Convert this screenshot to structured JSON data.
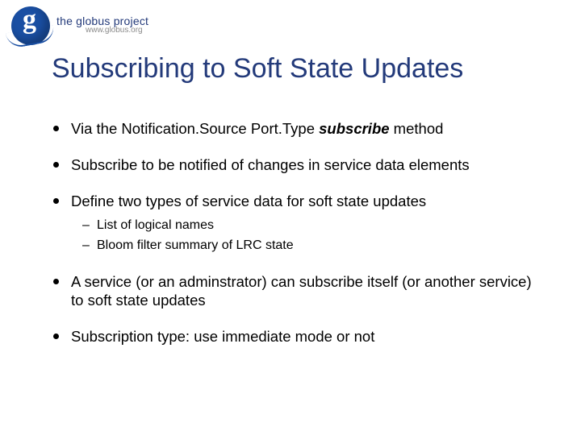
{
  "logo": {
    "title": "the globus project",
    "url": "www.globus.org"
  },
  "title": "Subscribing to Soft State Updates",
  "bullets": {
    "b1_pre": "Via the Notification.Source Port.Type ",
    "b1_kw": "subscribe",
    "b1_post": " method",
    "b2": "Subscribe to be notified of changes in service data elements",
    "b3": "Define two types of service data for soft state updates",
    "b3_sub1": "List of logical names",
    "b3_sub2": "Bloom filter summary of LRC state",
    "b4": "A service (or an adminstrator) can subscribe itself (or another service) to soft state updates",
    "b5": "Subscription type:  use immediate mode or not"
  }
}
